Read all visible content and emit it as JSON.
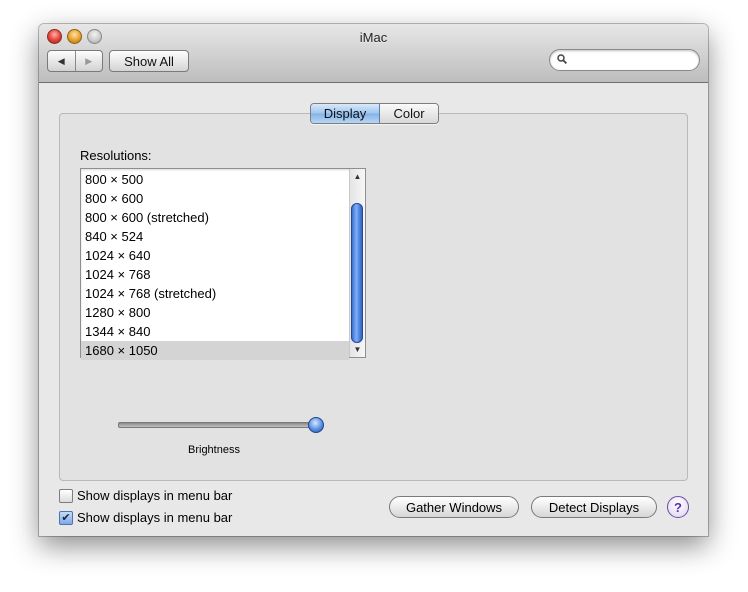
{
  "window": {
    "title": "iMac"
  },
  "toolbar": {
    "back_glyph": "◀",
    "forward_glyph": "▶",
    "show_all_label": "Show All",
    "search_placeholder": ""
  },
  "tabs": [
    {
      "label": "Display",
      "selected": true
    },
    {
      "label": "Color",
      "selected": false
    }
  ],
  "resolutions": {
    "label": "Resolutions:",
    "items": [
      "800 × 500",
      "800 × 600",
      "800 × 600 (stretched)",
      "840 × 524",
      "1024 × 640",
      "1024 × 768",
      "1024 × 768 (stretched)",
      "1280 × 800",
      "1344 × 840",
      "1680 × 1050"
    ],
    "selected_index": 9,
    "scroll_up_glyph": "▲",
    "scroll_down_glyph": "▼"
  },
  "brightness": {
    "label": "Brightness",
    "value_fraction": 1.0
  },
  "checkboxes": [
    {
      "label": "Show displays in menu bar",
      "checked": false,
      "glyph": ""
    },
    {
      "label": "Show displays in menu bar",
      "checked": true,
      "glyph": "✔"
    }
  ],
  "buttons": {
    "gather_windows": "Gather Windows",
    "detect_displays": "Detect Displays",
    "help": "?"
  },
  "colors": {
    "accent": "#4b83e0",
    "window_bg": "#e8e8e8",
    "selected_row": "#d4d4d4"
  }
}
